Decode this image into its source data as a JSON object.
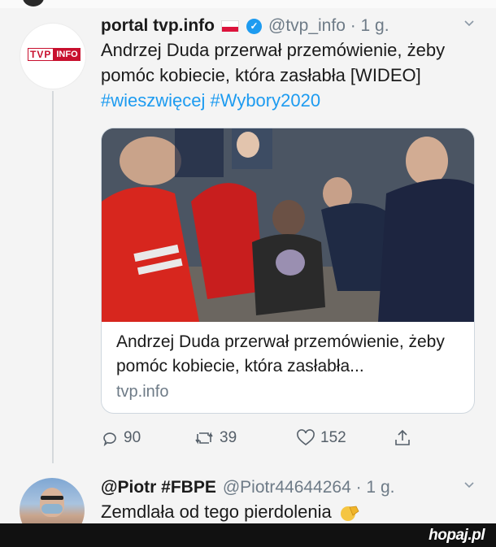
{
  "tweets": [
    {
      "name": "portal tvp.info",
      "handle": "@tvp_info · 1 g.",
      "text": "Andrzej Duda przerwał przemówienie, żeby pomóc kobiecie, która zasłabła [WIDEO] ",
      "hashtags": [
        "#wieszwięcej",
        "#Wybory2020"
      ],
      "avatar_logo": {
        "left": "TVP",
        "right": "INFO"
      },
      "card": {
        "title": "Andrzej Duda przerwał przemówienie, żeby pomóc kobiecie, która zasłabła...",
        "domain": "tvp.info"
      },
      "actions": {
        "replies": "90",
        "retweets": "39",
        "likes": "152"
      }
    },
    {
      "name": "@Piotr #FBPE",
      "handle": "@Piotr44644264 · 1 g.",
      "text": "Zemdlała od tego pierdolenia"
    }
  ],
  "watermark": "hopaj.pl",
  "colors": {
    "link": "#1d9bf0",
    "muted": "#6e7b87",
    "brand_red": "#c8102e",
    "verified": "#1d9bf0"
  },
  "icons": [
    "chevron-down-icon",
    "verified-badge-icon",
    "reply-icon",
    "retweet-icon",
    "like-icon",
    "share-icon",
    "facepalm-emoji"
  ]
}
